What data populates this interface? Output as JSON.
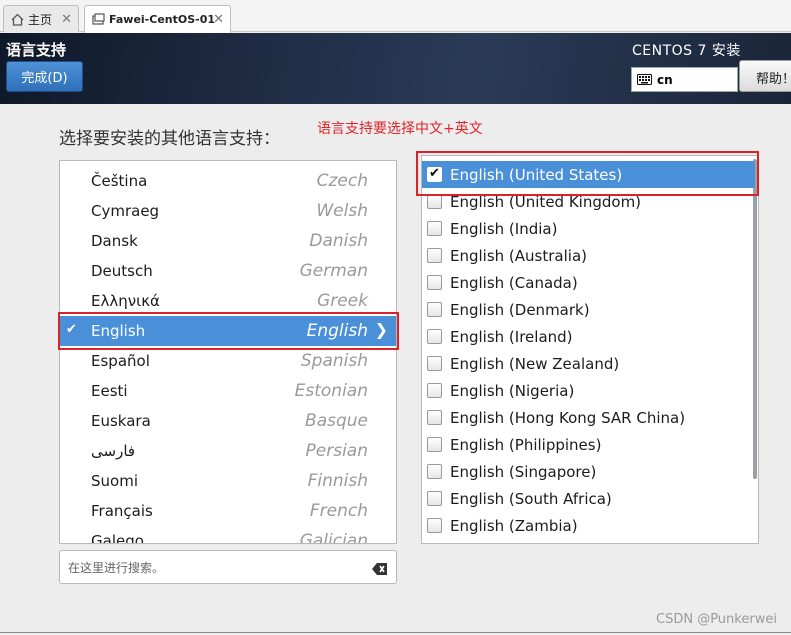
{
  "tabs": [
    {
      "label": "主页",
      "icon": "home-icon",
      "close": "✕"
    },
    {
      "label": "Fawei-CentOS-01",
      "icon": "vm-icon",
      "close": "✕"
    }
  ],
  "header": {
    "title": "语言支持",
    "done_label": "完成(D)",
    "product": "CENTOS 7 安装",
    "keyboard_layout": "cn",
    "keyboard_icon": "keyboard-icon",
    "help_label": "帮助！"
  },
  "main": {
    "prompt": "选择要安装的其他语言支持：",
    "annotation": "语言支持要选择中文+英文",
    "search_placeholder": "在这里进行搜索。"
  },
  "languages": [
    {
      "native": "Čeština",
      "english": "Czech"
    },
    {
      "native": "Cymraeg",
      "english": "Welsh"
    },
    {
      "native": "Dansk",
      "english": "Danish"
    },
    {
      "native": "Deutsch",
      "english": "German"
    },
    {
      "native": "Ελληνικά",
      "english": "Greek"
    },
    {
      "native": "English",
      "english": "English",
      "selected": true,
      "check": "✔",
      "arrow": "❯"
    },
    {
      "native": "Español",
      "english": "Spanish"
    },
    {
      "native": "Eesti",
      "english": "Estonian"
    },
    {
      "native": "Euskara",
      "english": "Basque"
    },
    {
      "native": "فارسی",
      "english": "Persian"
    },
    {
      "native": "Suomi",
      "english": "Finnish"
    },
    {
      "native": "Français",
      "english": "French"
    },
    {
      "native": "Galego",
      "english": "Galician"
    }
  ],
  "locales": [
    {
      "label": "English (United States)",
      "checked": true
    },
    {
      "label": "English (United Kingdom)",
      "checked": false
    },
    {
      "label": "English (India)",
      "checked": false
    },
    {
      "label": "English (Australia)",
      "checked": false
    },
    {
      "label": "English (Canada)",
      "checked": false
    },
    {
      "label": "English (Denmark)",
      "checked": false
    },
    {
      "label": "English (Ireland)",
      "checked": false
    },
    {
      "label": "English (New Zealand)",
      "checked": false
    },
    {
      "label": "English (Nigeria)",
      "checked": false
    },
    {
      "label": "English (Hong Kong SAR China)",
      "checked": false
    },
    {
      "label": "English (Philippines)",
      "checked": false
    },
    {
      "label": "English (Singapore)",
      "checked": false
    },
    {
      "label": "English (South Africa)",
      "checked": false
    },
    {
      "label": "English (Zambia)",
      "checked": false
    }
  ],
  "colors": {
    "accent": "#4a90d9",
    "highlight_box": "#d8232a",
    "header_bg": "#1f2d45"
  },
  "watermark": "CSDN @Punkerwei"
}
